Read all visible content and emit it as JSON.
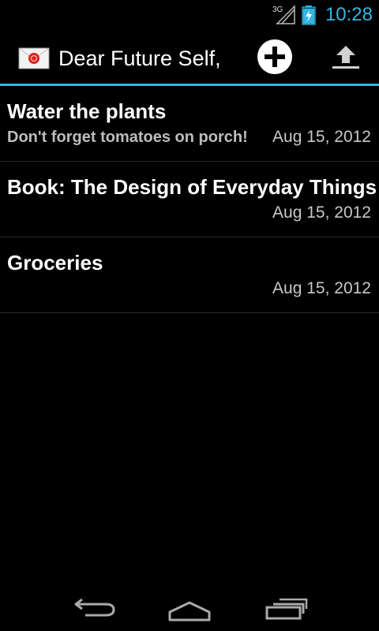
{
  "status_bar": {
    "network_label": "3G",
    "signal_icon": "signal-icon",
    "battery_icon": "battery-charging-icon",
    "clock": "10:28",
    "accent_color": "#33b5e5"
  },
  "action_bar": {
    "app_icon": "envelope-icon",
    "title": "Dear Future Self,",
    "add_icon": "add-circle-icon",
    "upload_icon": "upload-icon"
  },
  "notes": [
    {
      "title": "Water the plants",
      "subtitle": "Don't forget tomatoes on porch!",
      "date": "Aug 15, 2012"
    },
    {
      "title": "Book: The Design of Everyday Things",
      "subtitle": "",
      "date": "Aug 15, 2012"
    },
    {
      "title": "Groceries",
      "subtitle": "",
      "date": "Aug 15, 2012"
    }
  ],
  "nav_bar": {
    "back_icon": "back-icon",
    "home_icon": "home-icon",
    "recents_icon": "recents-icon"
  }
}
